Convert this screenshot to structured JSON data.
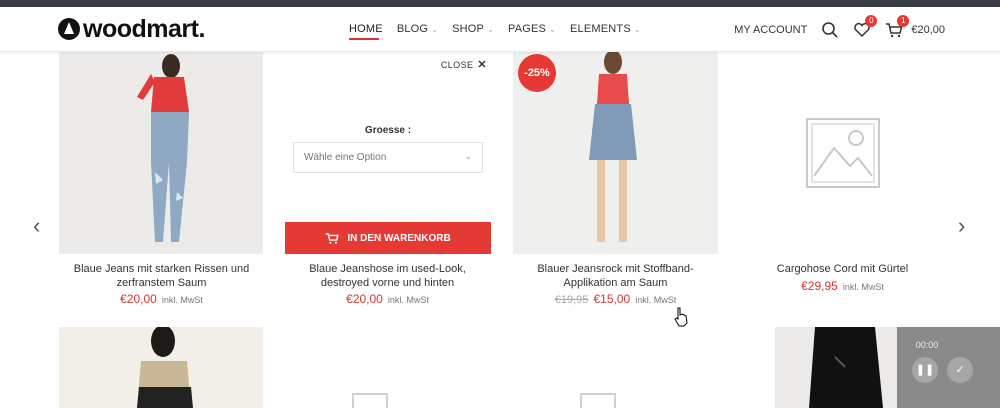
{
  "brand": {
    "logo_text": "woodmart."
  },
  "nav": {
    "items": [
      {
        "label": "HOME",
        "active": true,
        "dropdown": false
      },
      {
        "label": "BLOG",
        "dropdown": true
      },
      {
        "label": "SHOP",
        "dropdown": true
      },
      {
        "label": "PAGES",
        "dropdown": true
      },
      {
        "label": "ELEMENTS",
        "dropdown": true
      }
    ]
  },
  "header_right": {
    "account_label": "MY ACCOUNT",
    "wishlist_count": "0",
    "cart_count": "1",
    "cart_total": "€20,00"
  },
  "products": [
    {
      "name": "Blaue Jeans mit starken Rissen und zerfranstem Saum",
      "price": "€20,00",
      "tax": "inkl. MwSt"
    },
    {
      "name": "Blaue Jeanshose im used-Look, destroyed vorne und hinten",
      "price": "€20,00",
      "tax": "inkl. MwSt"
    },
    {
      "name": "Blauer Jeansrock mit Stoffband-Applikation am Saum",
      "old_price": "€19,95",
      "price": "€15,00",
      "tax": "inkl. MwSt",
      "badge": "-25%"
    },
    {
      "name": "Cargohose Cord mit Gürtel",
      "price": "€29,95",
      "tax": "inkl. MwSt"
    }
  ],
  "quick_shop": {
    "close_label": "CLOSE",
    "size_label": "Groesse :",
    "select_placeholder": "Wähle eine Option",
    "add_to_cart_label": "IN DEN WARENKORB"
  },
  "video": {
    "time": "00:00"
  },
  "colors": {
    "accent": "#e53935",
    "price": "#d33333"
  }
}
